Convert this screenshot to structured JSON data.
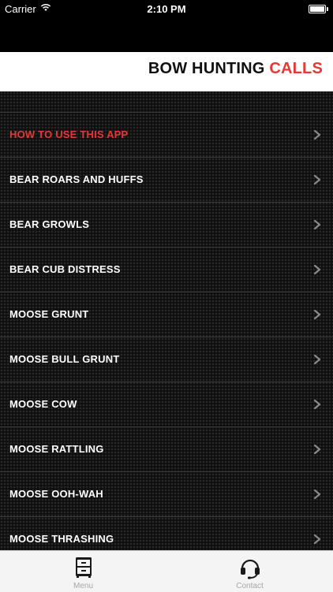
{
  "status_bar": {
    "carrier": "Carrier",
    "time": "2:10 PM"
  },
  "header": {
    "title_part1": "BOW HUNTING",
    "title_part2": "CALLS"
  },
  "menu_items": [
    {
      "label": "HOW TO USE THIS APP"
    },
    {
      "label": "BEAR ROARS AND HUFFS"
    },
    {
      "label": "BEAR GROWLS"
    },
    {
      "label": "BEAR CUB DISTRESS"
    },
    {
      "label": "MOOSE GRUNT"
    },
    {
      "label": "MOOSE BULL GRUNT"
    },
    {
      "label": "MOOSE COW"
    },
    {
      "label": "MOOSE RATTLING"
    },
    {
      "label": "MOOSE OOH-WAH"
    },
    {
      "label": "MOOSE THRASHING"
    }
  ],
  "tabs": [
    {
      "label": "Menu",
      "icon": "cabinet-icon"
    },
    {
      "label": "Contact",
      "icon": "headset-icon"
    }
  ],
  "colors": {
    "accent": "#e53935",
    "background": "#141414"
  }
}
